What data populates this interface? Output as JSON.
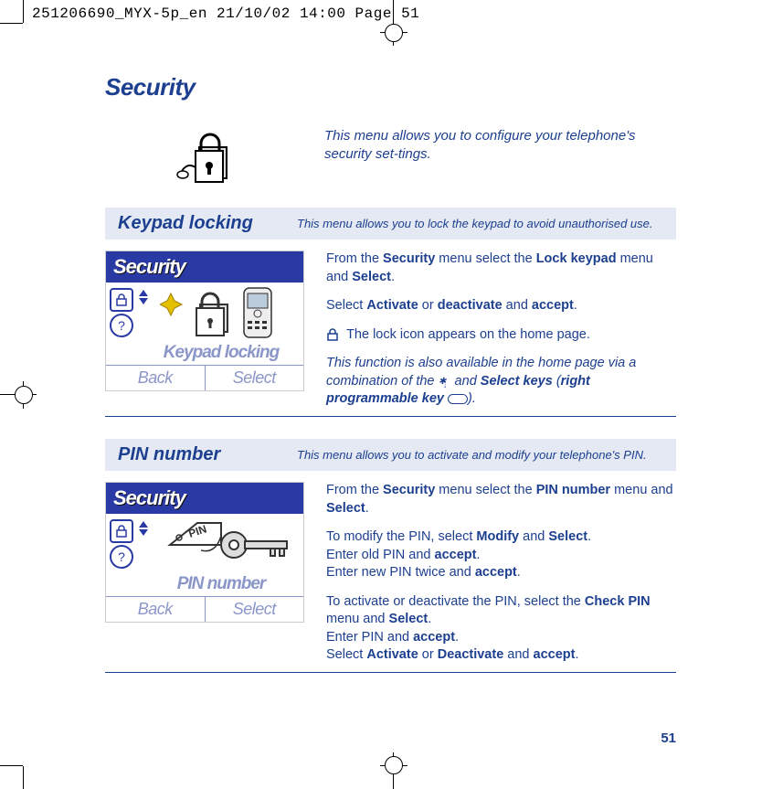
{
  "meta_header": "251206690_MYX-5p_en  21/10/02  14:00  Page 51",
  "page_number": "51",
  "title": "Security",
  "intro": "This menu allows you to configure your telephone's security set-tings.",
  "section1": {
    "title": "Keypad locking",
    "desc": "This menu allows you to lock the keypad to avoid unauthorised use.",
    "phone": {
      "titlebar": "Security",
      "menu_label": "Keypad locking",
      "softleft": "Back",
      "softright": "Select"
    },
    "body": {
      "p1a": "From the ",
      "p1b": "Security",
      "p1c": " menu select the ",
      "p1d": "Lock keypad",
      "p1e": " menu and ",
      "p1f": "Select",
      "p1g": ".",
      "p2a": "Select ",
      "p2b": "Activate",
      "p2c": " or ",
      "p2d": "deactivate",
      "p2e": " and ",
      "p2f": "accept",
      "p2g": ".",
      "p3": "The lock icon appears on the home page.",
      "p4a": "This function is also available in the home page via a combination of the ",
      "p4b": " and ",
      "p4c": "Select keys",
      "p4d": " (",
      "p4e": "right programmable key",
      "p4f": " ",
      "p4g": ")."
    }
  },
  "section2": {
    "title": "PIN number",
    "desc": "This menu allows you to activate and modify your telephone's PIN.",
    "phone": {
      "titlebar": "Security",
      "menu_label": "PIN number",
      "softleft": "Back",
      "softright": "Select"
    },
    "body": {
      "p1a": "From the ",
      "p1b": "Security",
      "p1c": " menu select the ",
      "p1d": "PIN number",
      "p1e": " menu and ",
      "p1f": "Select",
      "p1g": ".",
      "p2a": "To modify the PIN, select ",
      "p2b": "Modify",
      "p2c": " and ",
      "p2d": "Select",
      "p2e": ".",
      "p3a": "Enter old PIN and ",
      "p3b": "accept",
      "p3c": ".",
      "p4a": "Enter new PIN twice and ",
      "p4b": "accept",
      "p4c": ".",
      "p5a": "To activate or deactivate the PIN, select the ",
      "p5b": "Check PIN",
      "p5c": " menu and ",
      "p5d": "Select",
      "p5e": ".",
      "p6a": "Enter PIN and ",
      "p6b": "accept",
      "p6c": ".",
      "p7a": "Select ",
      "p7b": "Activate",
      "p7c": " or ",
      "p7d": "Deactivate",
      "p7e": " and ",
      "p7f": "accept",
      "p7g": "."
    }
  }
}
